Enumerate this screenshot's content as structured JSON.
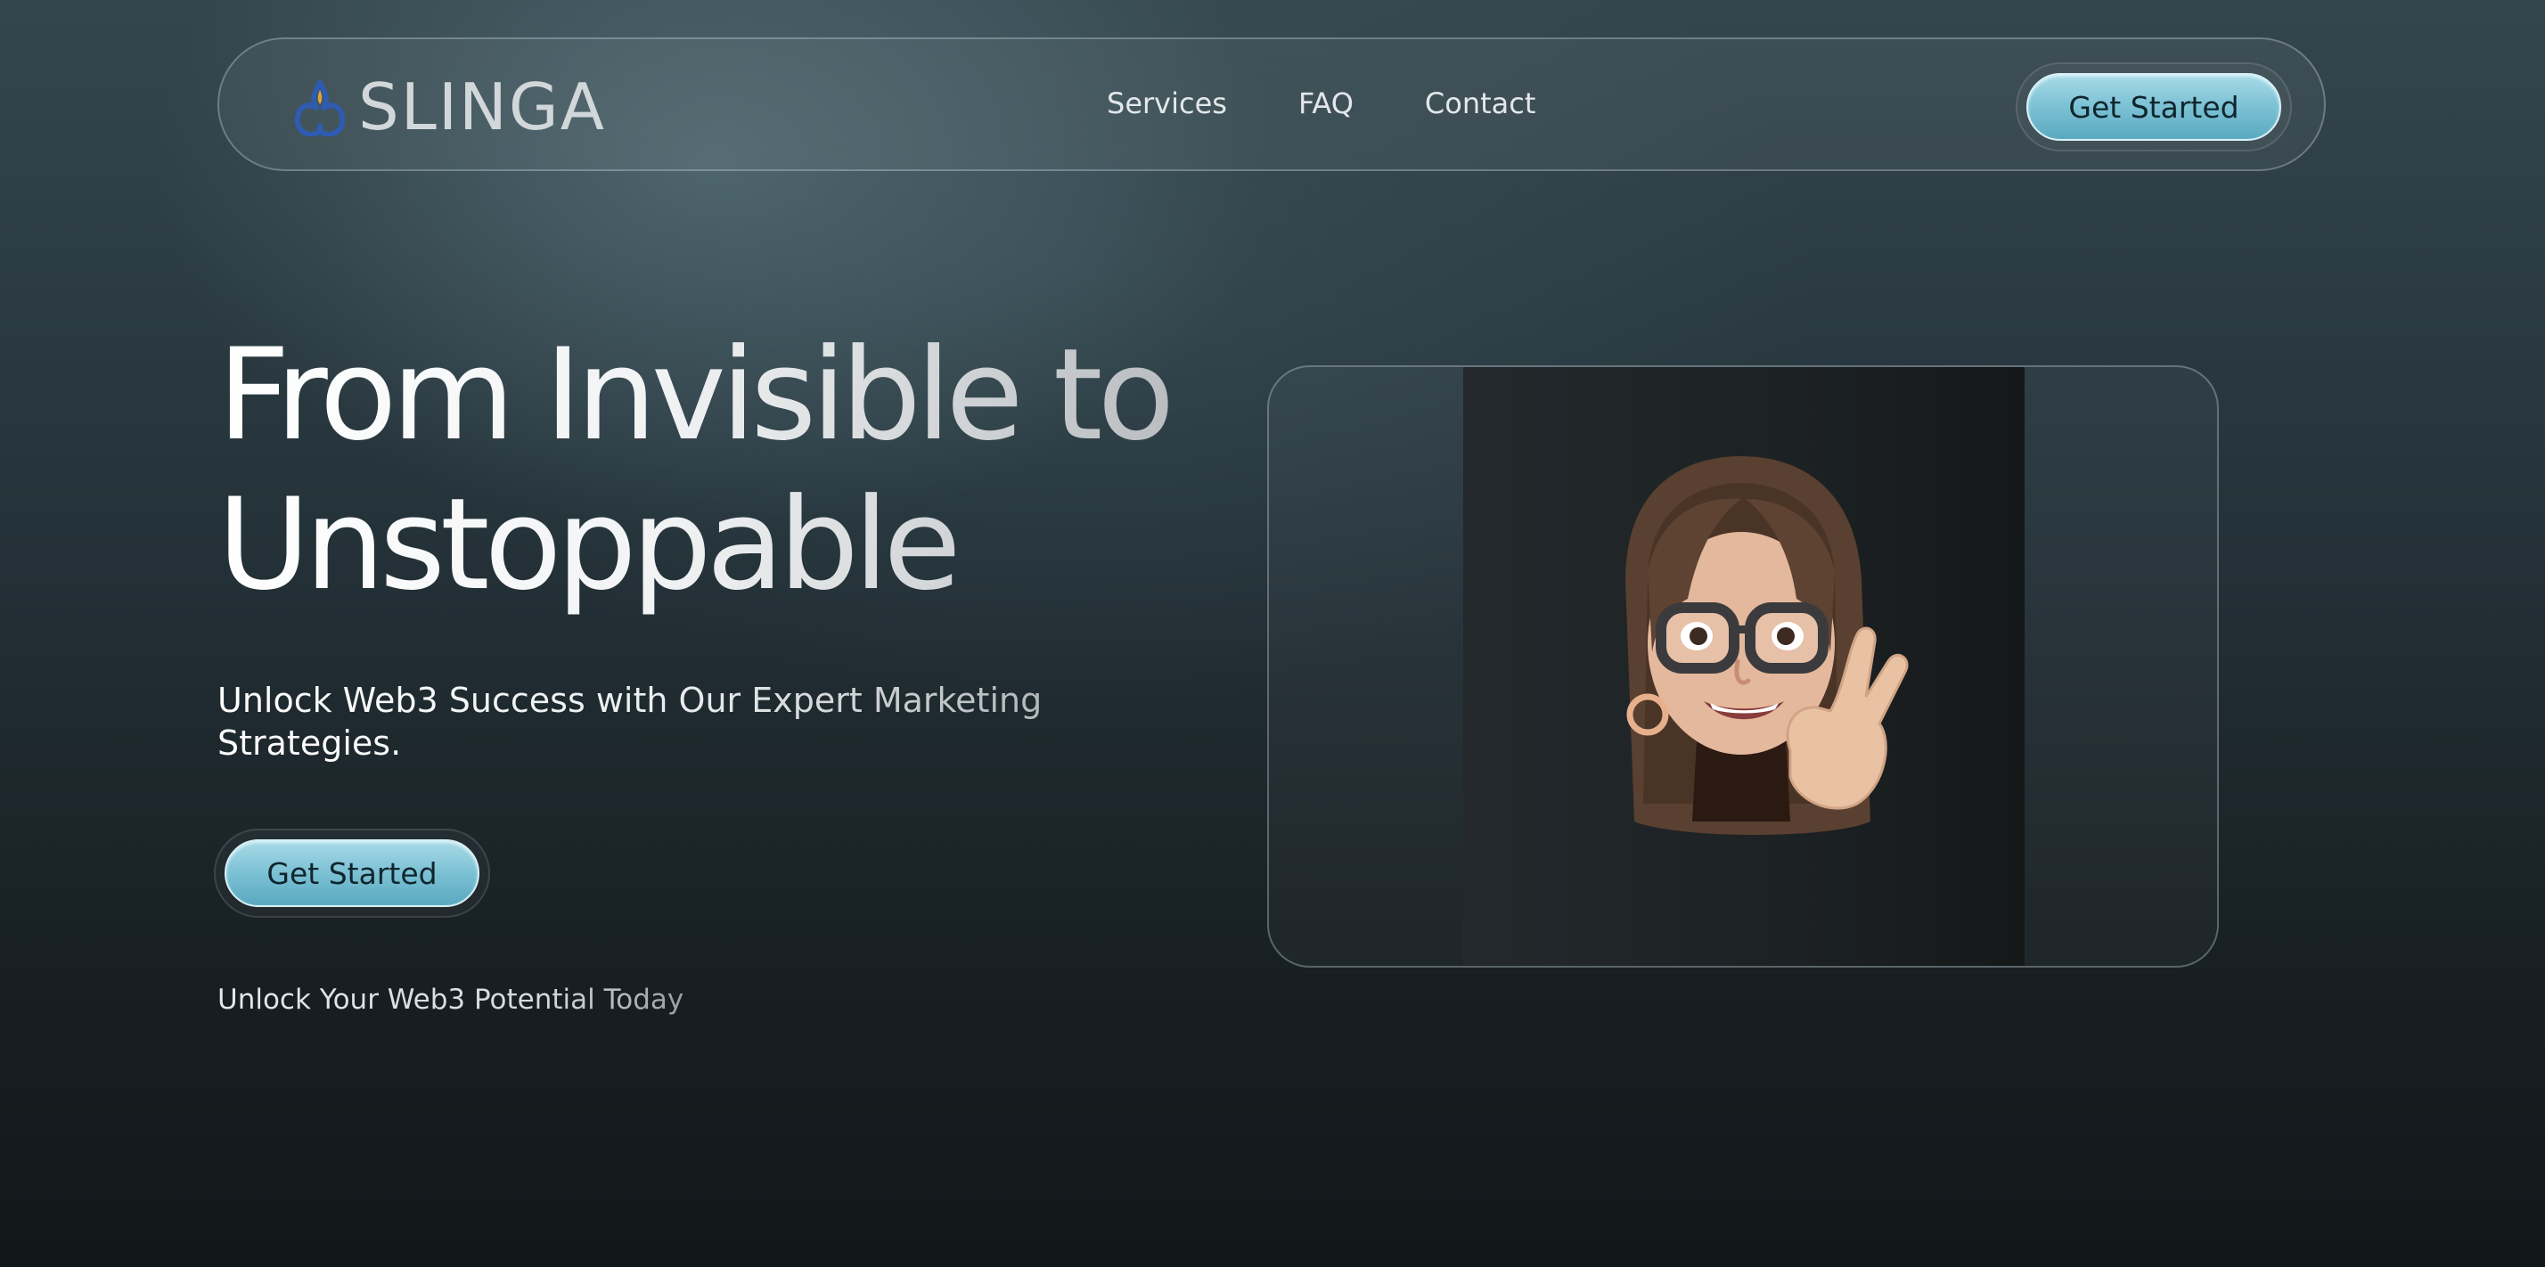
{
  "nav": {
    "brand_name": "SLINGA",
    "logo_icon": "flame-drop-logo-icon",
    "links": [
      "Services",
      "FAQ",
      "Contact"
    ],
    "cta_label": "Get Started"
  },
  "hero": {
    "headline_line1": "From Invisible to",
    "headline_line2": "Unstoppable",
    "subhead": "Unlock Web3 Success with Our Expert Marketing Strategies.",
    "cta_label": "Get Started",
    "tagline": "Unlock Your Web3 Potential Today"
  },
  "media": {
    "avatar_icon": "memoji-peace-sign-avatar-icon"
  },
  "colors": {
    "accent": "#7fc3d6",
    "accent_light": "#a8dbe8",
    "background_top": "#34464d",
    "background_bottom": "#121719",
    "logo_blue": "#2f5bb0",
    "logo_gold": "#d9a53a"
  }
}
